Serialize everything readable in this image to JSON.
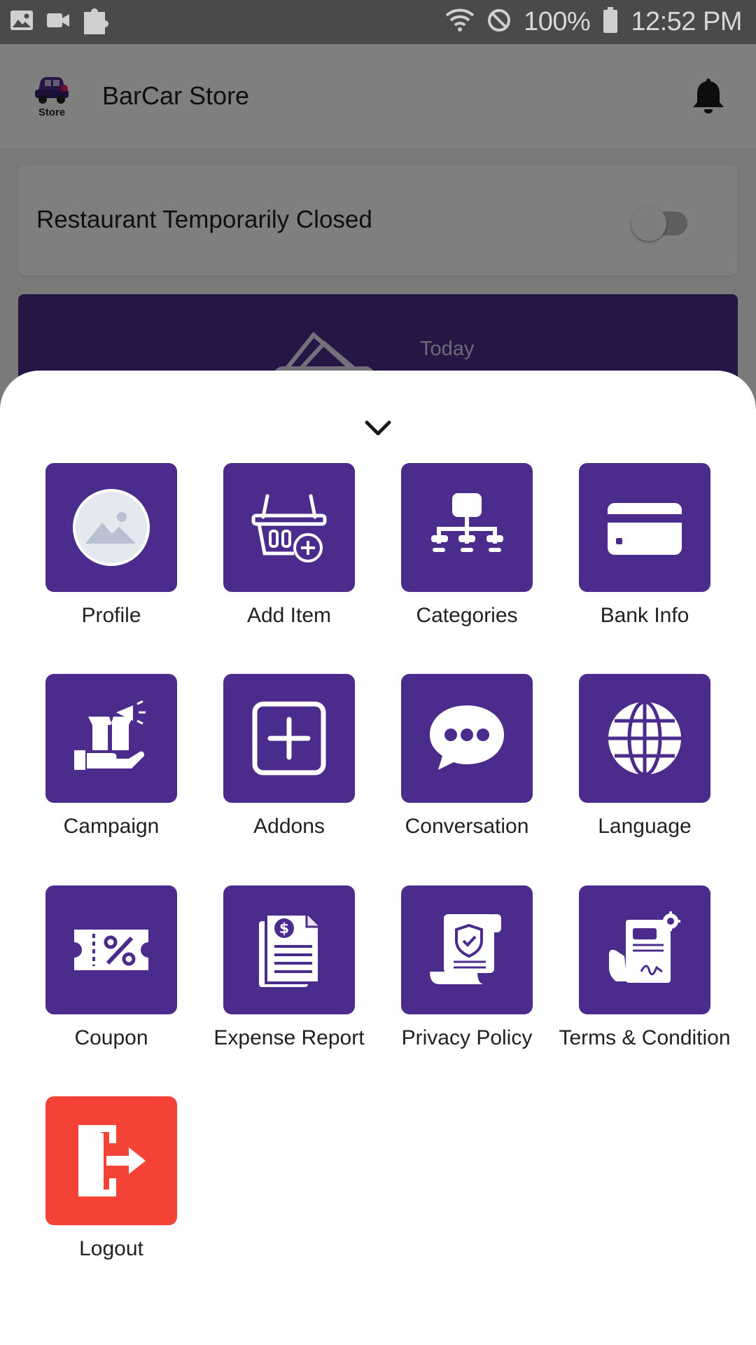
{
  "status_bar": {
    "icons": [
      "image-icon",
      "video-icon",
      "puzzle-icon",
      "wifi-icon",
      "do-not-disturb-icon",
      "battery-icon"
    ],
    "battery": "100%",
    "time": "12:52 PM"
  },
  "app_bar": {
    "logo_caption": "Store",
    "title": "BarCar Store",
    "notification_icon": "bell-icon"
  },
  "background": {
    "closed_label": "Restaurant Temporarily Closed",
    "closed_toggle_on": false,
    "earnings_label": "Today"
  },
  "sheet": {
    "collapse_icon": "chevron-down-icon",
    "items": [
      {
        "label": "Profile",
        "icon": "profile-image-icon"
      },
      {
        "label": "Add Item",
        "icon": "basket-add-icon"
      },
      {
        "label": "Categories",
        "icon": "hierarchy-icon"
      },
      {
        "label": "Bank Info",
        "icon": "credit-card-icon"
      },
      {
        "label": "Campaign",
        "icon": "campaign-icon"
      },
      {
        "label": "Addons",
        "icon": "plus-square-icon"
      },
      {
        "label": "Conversation",
        "icon": "chat-bubble-icon"
      },
      {
        "label": "Language",
        "icon": "globe-icon"
      },
      {
        "label": "Coupon",
        "icon": "coupon-icon"
      },
      {
        "label": "Expense Report",
        "icon": "expense-report-icon"
      },
      {
        "label": "Privacy Policy",
        "icon": "privacy-policy-icon"
      },
      {
        "label": "Terms & Condition",
        "icon": "terms-contract-icon"
      },
      {
        "label": "Logout",
        "icon": "logout-icon"
      }
    ],
    "colors": {
      "tile": "#4b2c8c",
      "logout_tile": "#f44336"
    }
  }
}
